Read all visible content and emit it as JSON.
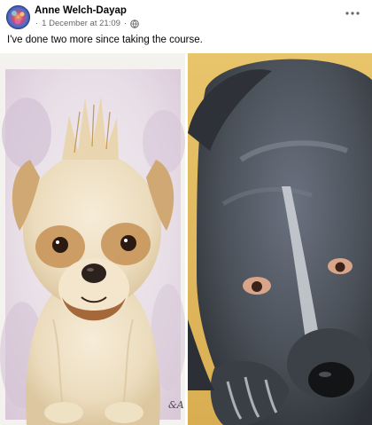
{
  "post": {
    "author": "Anne Welch-Dayap",
    "date": "1 December at 21:09",
    "separator": "·",
    "visibility_icon": "globe-icon",
    "more_icon": "more-options-icon",
    "caption": "I've done two more since taking the course."
  },
  "photos": [
    {
      "subject": "small fluffy dog watercolour portrait",
      "signature_initials": "&A"
    },
    {
      "subject": "grey staffordshire terrier watercolour portrait"
    }
  ],
  "colors": {
    "text_primary": "#050505",
    "text_secondary": "#65676b"
  }
}
